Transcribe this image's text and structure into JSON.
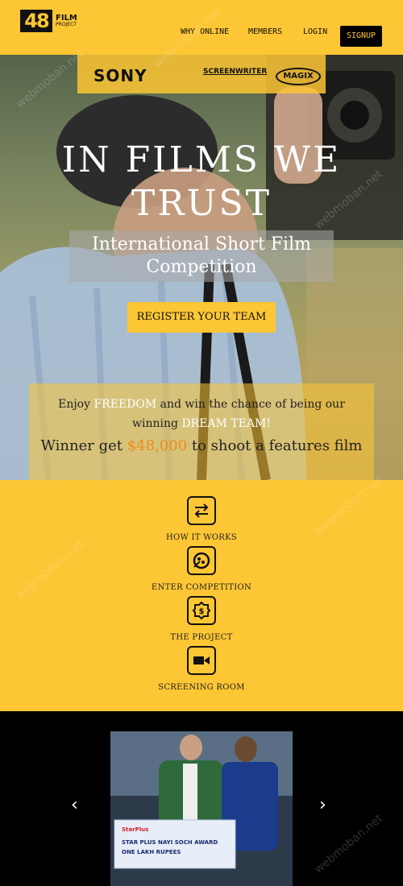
{
  "logo": {
    "number": "48",
    "line1": "FILM",
    "line2": "PROJECT"
  },
  "nav": {
    "why_online": "WHY ONLINE",
    "members": "MEMBERS",
    "login": "LOGIN",
    "signup": "SIGNUP"
  },
  "sponsors": {
    "sony": "SONY",
    "screenwriter": "SCREENWRITER",
    "magix": "MAGIX"
  },
  "hero": {
    "title": "IN FILMS WE TRUST",
    "subtitle": "International Short Film Competition",
    "register_button": "REGISTER YOUR TEAM",
    "promo_prefix": "Enjoy ",
    "promo_freedom": "FREEDOM",
    "promo_mid": " and win the chance of being our winning ",
    "promo_dream": "DREAM TEAM!",
    "winner_prefix": "Winner get ",
    "winner_amount": "$48,000",
    "winner_suffix": " to shoot a features film"
  },
  "features": [
    {
      "label": "HOW IT WORKS",
      "icon": "exchange-arrows-icon"
    },
    {
      "label": "ENTER COMPETITION",
      "icon": "film-reel-icon"
    },
    {
      "label": "THE PROJECT",
      "icon": "badge-dollar-icon"
    },
    {
      "label": "SCREENING ROOM",
      "icon": "video-camera-icon"
    }
  ],
  "carousel": {
    "prev": "‹",
    "next": "›",
    "photo_text_1": "STAR PLUS NAYI SOCH AWARD",
    "photo_text_2": "ONE LAKH RUPEES",
    "photo_brand": "StarPlus"
  },
  "watermark": "webmoban.net",
  "colors": {
    "accent": "#fdc634",
    "highlight": "#f08c1a",
    "dark": "#111111"
  }
}
